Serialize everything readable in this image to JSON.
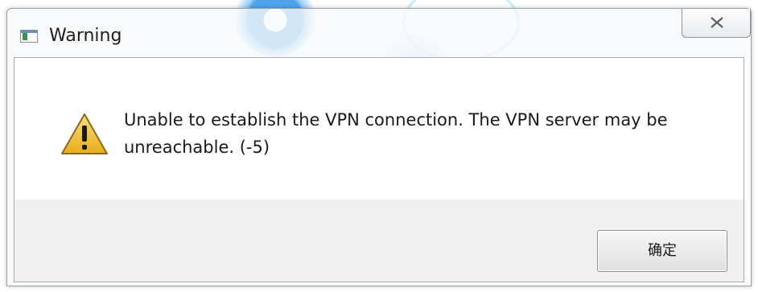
{
  "window": {
    "title": "Warning"
  },
  "dialog": {
    "message": "Unable to establish the VPN connection. The VPN server may be unreachable. (-5)",
    "ok_label": "确定"
  },
  "icons": {
    "app": "app-window-icon",
    "close": "close-icon",
    "warning": "warning-icon"
  },
  "colors": {
    "warning_fill": "#f3c534",
    "button_area": "#f0f0f0"
  }
}
